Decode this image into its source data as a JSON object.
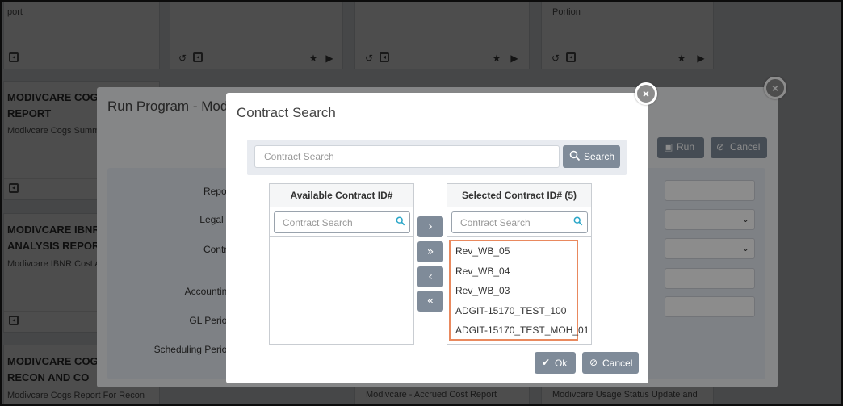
{
  "background_cards": [
    {
      "title": "",
      "desc": "port"
    },
    {
      "title": "",
      "desc": ""
    },
    {
      "title": "",
      "desc": ""
    },
    {
      "title": "",
      "desc": "Portion"
    },
    {
      "title": "MODIVCARE COGS SU REPORT",
      "desc": "Modivcare Cogs Summary"
    },
    {
      "title": "MODIVCARE IBNR CO ANALYSIS REPORT",
      "desc": "Modivcare IBNR Cost Ana"
    },
    {
      "title": "MODIVCARE COGS RE FOR RECON AND CO",
      "desc": "Modivcare Cogs Report For Recon"
    },
    {
      "title": "",
      "desc": "Modivcare - Accrued Cost Report"
    },
    {
      "title": "",
      "desc": "Modivcare Usage Status Update and"
    }
  ],
  "run_modal": {
    "title": "Run Program - Mod",
    "run_label": "Run",
    "cancel_label": "Cancel",
    "form_labels": [
      "Report",
      "Legal E",
      "Contra",
      "Accounting",
      "GL Period",
      "Scheduling Period"
    ]
  },
  "contract_search": {
    "title": "Contract Search",
    "search_placeholder": "Contract Search",
    "search_button": "Search",
    "available_header": "Available Contract ID#",
    "available_filter_placeholder": "Contract Search",
    "available_items": [],
    "selected_header": "Selected Contract ID# (5)",
    "selected_filter_placeholder": "Contract Search",
    "selected_items": [
      "Rev_WB_05",
      "Rev_WB_04",
      "Rev_WB_03",
      "ADGIT-15170_TEST_100",
      "ADGIT-15170_TEST_MOH_01"
    ],
    "move_buttons": [
      "›",
      "»",
      "‹",
      "«"
    ],
    "ok_label": "Ok",
    "cancel_label": "Cancel"
  },
  "colors": {
    "button_gray": "#7f8b99",
    "selection_border": "#e9895e",
    "search_icon": "#2aa6c8"
  }
}
